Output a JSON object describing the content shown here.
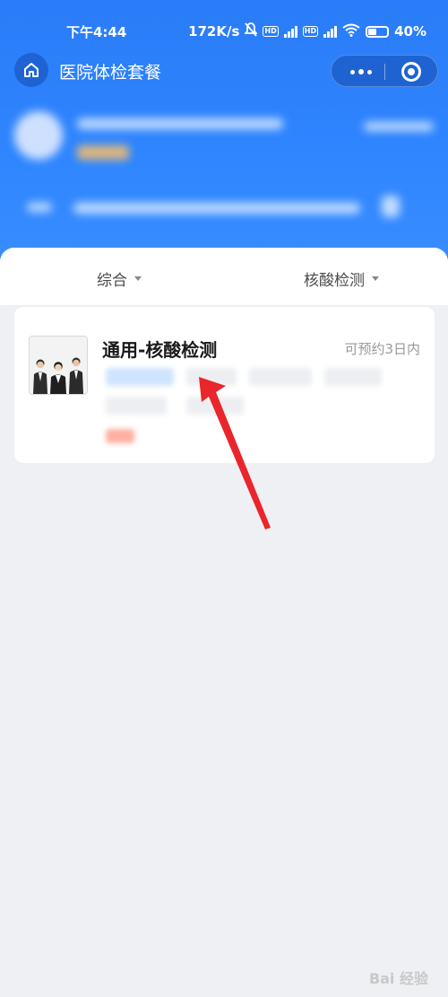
{
  "status_bar": {
    "time": "下午4:44",
    "network_speed": "172K/s",
    "battery": "40%"
  },
  "nav": {
    "title": "医院体检套餐"
  },
  "filters": {
    "sort_label": "综合",
    "category_label": "核酸检测"
  },
  "package_card": {
    "title": "通用-核酸检测",
    "availability": "可预约3日内"
  },
  "watermark": "Bai 经验",
  "colors": {
    "header_blue": "#2f86ff",
    "capsule_blue": "#1f63d2",
    "annotation_red": "#e8262b"
  }
}
